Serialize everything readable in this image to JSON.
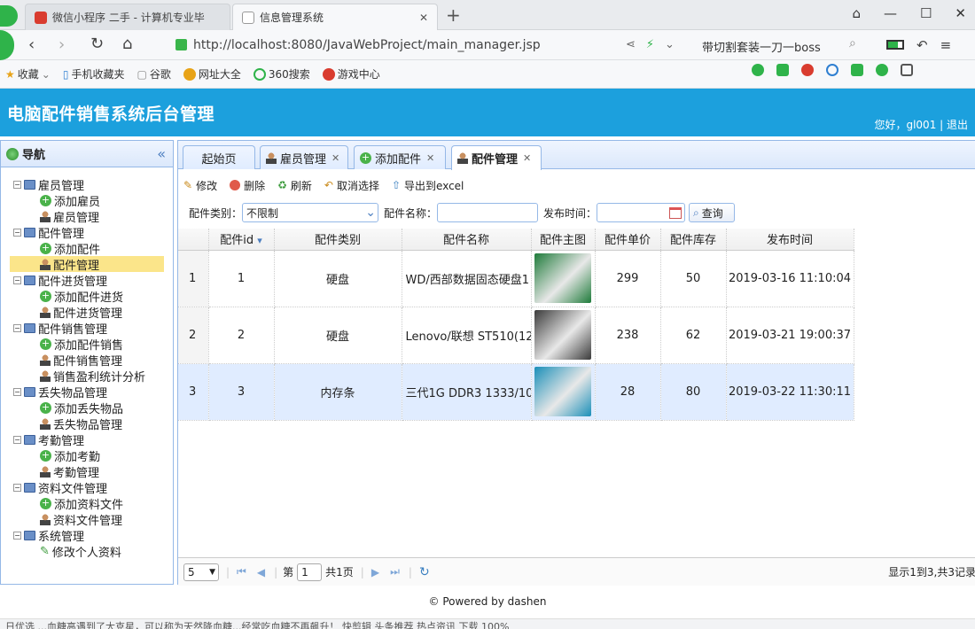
{
  "browser": {
    "tabs": [
      {
        "label": "微信小程序 二手 - 计算机专业毕"
      },
      {
        "label": "信息管理系统"
      }
    ],
    "new_tab": "+",
    "url": "http://localhost:8080/JavaWebProject/main_manager.jsp",
    "search_text": "带切割套装一刀一boss",
    "bookmarks": [
      "收藏",
      "手机收藏夹",
      "谷歌",
      "网址大全",
      "360搜索",
      "游戏中心"
    ]
  },
  "app": {
    "title": "电脑配件销售系统后台管理",
    "greeting": "您好，gl001 | 退出"
  },
  "sidebar": {
    "title": "导航",
    "collapse": "«",
    "items": [
      {
        "label": "雇员管理",
        "level": 0
      },
      {
        "label": "添加雇员",
        "level": 1,
        "icon": "add-icon"
      },
      {
        "label": "雇员管理",
        "level": 1,
        "icon": "user-icon"
      },
      {
        "label": "配件管理",
        "level": 0
      },
      {
        "label": "添加配件",
        "level": 1,
        "icon": "add-icon"
      },
      {
        "label": "配件管理",
        "level": 1,
        "icon": "user-icon",
        "selected": true
      },
      {
        "label": "配件进货管理",
        "level": 0
      },
      {
        "label": "添加配件进货",
        "level": 1,
        "icon": "add-icon"
      },
      {
        "label": "配件进货管理",
        "level": 1,
        "icon": "user-icon"
      },
      {
        "label": "配件销售管理",
        "level": 0
      },
      {
        "label": "添加配件销售",
        "level": 1,
        "icon": "add-icon"
      },
      {
        "label": "配件销售管理",
        "level": 1,
        "icon": "user-icon"
      },
      {
        "label": "销售盈利统计分析",
        "level": 1,
        "icon": "user-icon"
      },
      {
        "label": "丢失物品管理",
        "level": 0
      },
      {
        "label": "添加丢失物品",
        "level": 1,
        "icon": "add-icon"
      },
      {
        "label": "丢失物品管理",
        "level": 1,
        "icon": "user-icon"
      },
      {
        "label": "考勤管理",
        "level": 0
      },
      {
        "label": "添加考勤",
        "level": 1,
        "icon": "add-icon"
      },
      {
        "label": "考勤管理",
        "level": 1,
        "icon": "user-icon"
      },
      {
        "label": "资料文件管理",
        "level": 0
      },
      {
        "label": "添加资料文件",
        "level": 1,
        "icon": "add-icon"
      },
      {
        "label": "资料文件管理",
        "level": 1,
        "icon": "user-icon"
      },
      {
        "label": "系统管理",
        "level": 0
      },
      {
        "label": "修改个人资料",
        "level": 1,
        "icon": "pencil-icon"
      }
    ]
  },
  "tabs": [
    {
      "label": "起始页"
    },
    {
      "label": "雇员管理"
    },
    {
      "label": "添加配件"
    },
    {
      "label": "配件管理",
      "active": true
    }
  ],
  "toolbar": {
    "edit": "修改",
    "delete": "删除",
    "refresh": "刷新",
    "cancel_select": "取消选择",
    "export": "导出到excel"
  },
  "search": {
    "category_label": "配件类别：",
    "category_value": "不限制",
    "name_label": "配件名称：",
    "name_value": "",
    "date_label": "发布时间：",
    "date_value": "",
    "query": "查询"
  },
  "table": {
    "columns": [
      "配件id",
      "配件类别",
      "配件名称",
      "配件主图",
      "配件单价",
      "配件库存",
      "发布时间"
    ],
    "sort_indicator": "▾",
    "rows": [
      {
        "rownum": "1",
        "id": "1",
        "category": "硬盘",
        "name": "WD/西部数据固态硬盘1",
        "price": "299",
        "stock": "50",
        "date": "2019-03-16 11:10:04",
        "image_color": "#1e7b3a"
      },
      {
        "rownum": "2",
        "id": "2",
        "category": "硬盘",
        "name": "Lenovo/联想 ST510(12",
        "price": "238",
        "stock": "62",
        "date": "2019-03-21 19:00:37",
        "image_color": "#3a3a3a"
      },
      {
        "rownum": "3",
        "id": "3",
        "category": "内存条",
        "name": "三代1G DDR3 1333/10",
        "price": "28",
        "stock": "80",
        "date": "2019-03-22 11:30:11",
        "image_color": "#1a8fb8"
      }
    ]
  },
  "pager": {
    "page_size": "5",
    "page_label": "第",
    "page_value": "1",
    "total_pages": "共1页",
    "summary": "显示1到3,共3记录"
  },
  "footer": "© Powered by dashen",
  "bottom_strip": "日优选   ...血糖高遇到了大克星，可以称为天然降血糖...经常吃血糖不再飙升！   快剪辑   头条推荐   热点资讯   下载   100%"
}
